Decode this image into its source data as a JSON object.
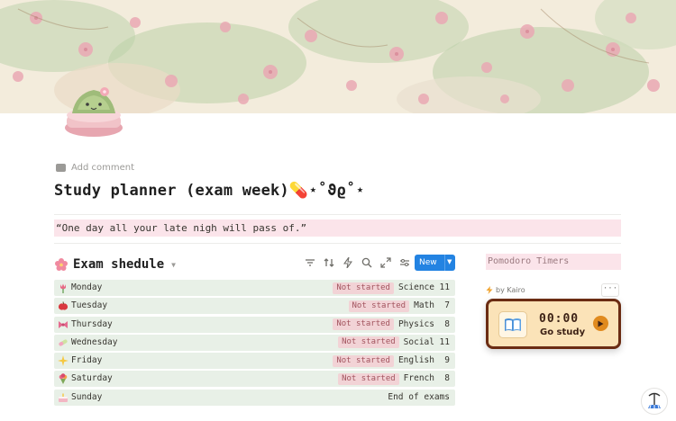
{
  "cover": {
    "theme": "pink-blossom-watercolor",
    "colors": [
      "#f3ecdc",
      "#b9cfa7",
      "#eaa9b4",
      "#d98c9a"
    ]
  },
  "page": {
    "icon": "matcha-cake-icon",
    "add_comment_label": "Add comment",
    "title": "Study planner (exam week)💊⋆˚ϑϱ˚⋆",
    "quote": "“One day all your late nigh will pass of.”"
  },
  "database": {
    "icon": "sakura-icon",
    "title": "Exam shedule",
    "new_label": "New",
    "rows": [
      {
        "emoji": "tulip-icon",
        "day": "Monday",
        "status": "Not started",
        "subject": "Science",
        "count": "11"
      },
      {
        "emoji": "apple-icon",
        "day": "Tuesday",
        "status": "Not started",
        "subject": "Math",
        "count": "7"
      },
      {
        "emoji": "ribbon-icon",
        "day": "Thursday",
        "status": "Not started",
        "subject": "Physics",
        "count": "8"
      },
      {
        "emoji": "pill-icon",
        "day": "Wednesday",
        "status": "Not started",
        "subject": "Social",
        "count": "11"
      },
      {
        "emoji": "sparkle-icon",
        "day": "Friday",
        "status": "Not started",
        "subject": "English",
        "count": "9"
      },
      {
        "emoji": "bouquet-icon",
        "day": "Saturday",
        "status": "Not started",
        "subject": "French",
        "count": "8"
      },
      {
        "emoji": "cake-icon",
        "day": "Sunday",
        "status": "",
        "subject": "End of exams",
        "count": ""
      }
    ]
  },
  "pomodoro": {
    "heading": "Pomodoro Timers",
    "by_label": "by Kairo",
    "more_label": "···",
    "time": "00:00",
    "action_label": "Go study"
  },
  "accent": {
    "new_button": "#2383e2",
    "status_bg": "#f2d3d6",
    "status_text": "#a2545e",
    "row_bg": "#e8f0e7",
    "widget_border": "#6b2c13"
  }
}
